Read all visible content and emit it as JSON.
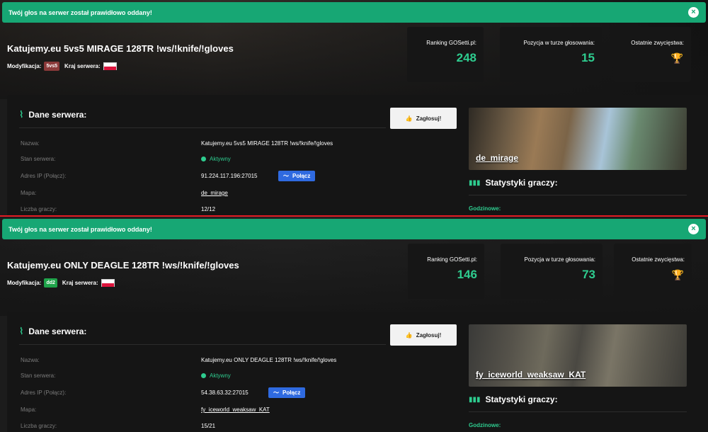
{
  "panels": [
    {
      "notice": "Twój głos na serwer został prawidłowo oddany!",
      "close_icon": "×",
      "server_title": "Katujemy.eu 5vs5 MIRAGE 128TR !ws/!knife/!gloves",
      "mod_label": "Modyfikacja:",
      "mod_badge": "5vs5",
      "mod_badge_color": "#8b3a3a",
      "country_label": "Kraj serwera:",
      "stats": [
        {
          "label": "Ranking GOSetti.pl:",
          "value": "248"
        },
        {
          "label": "Pozycja w turze głosowania:",
          "value": "15"
        },
        {
          "label": "Ostatnie zwycięstwa:",
          "trophy_color": "#b8652a"
        }
      ],
      "section_title": "Dane serwera:",
      "vote_label": "Zagłosuj!",
      "rows": [
        {
          "label": "Nazwa:",
          "value": "Katujemy.eu 5vs5 MIRAGE 128TR !ws/!knife/!gloves"
        },
        {
          "label": "Stan serwera:",
          "value": "Aktywny"
        },
        {
          "label": "Adres IP (Połącz):",
          "value": "91.224.117.196:27015"
        },
        {
          "label": "Mapa:",
          "value": "de_mirage"
        },
        {
          "label": "Liczba graczy:",
          "value": "12/12"
        }
      ],
      "connect_label": "Połącz",
      "map_name": "de_mirage",
      "player_stats_title": "Statystyki graczy:",
      "hourly_label": "Godzinowe:"
    },
    {
      "notice": "Twój głos na serwer został prawidłowo oddany!",
      "close_icon": "×",
      "server_title": "Katujemy.eu ONLY DEAGLE 128TR !ws/!knife/!gloves",
      "mod_label": "Modyfikacja:",
      "mod_badge": "dd2",
      "mod_badge_color": "#1fa34a",
      "country_label": "Kraj serwera:",
      "stats": [
        {
          "label": "Ranking GOSetti.pl:",
          "value": "146"
        },
        {
          "label": "Pozycja w turze głosowania:",
          "value": "73"
        },
        {
          "label": "Ostatnie zwycięstwa:",
          "trophy_color": "#e3b21a"
        }
      ],
      "section_title": "Dane serwera:",
      "vote_label": "Zagłosuj!",
      "rows": [
        {
          "label": "Nazwa:",
          "value": "Katujemy.eu ONLY DEAGLE 128TR !ws/!knife/!gloves"
        },
        {
          "label": "Stan serwera:",
          "value": "Aktywny"
        },
        {
          "label": "Adres IP (Połącz):",
          "value": "54.38.63.32:27015"
        },
        {
          "label": "Mapa:",
          "value": "fy_iceworld_weaksaw_KAT"
        },
        {
          "label": "Liczba graczy:",
          "value": "15/21"
        }
      ],
      "connect_label": "Połącz",
      "map_name": "fy_iceworld_weaksaw_KAT",
      "player_stats_title": "Statystyki graczy:",
      "hourly_label": "Godzinowe:"
    }
  ]
}
